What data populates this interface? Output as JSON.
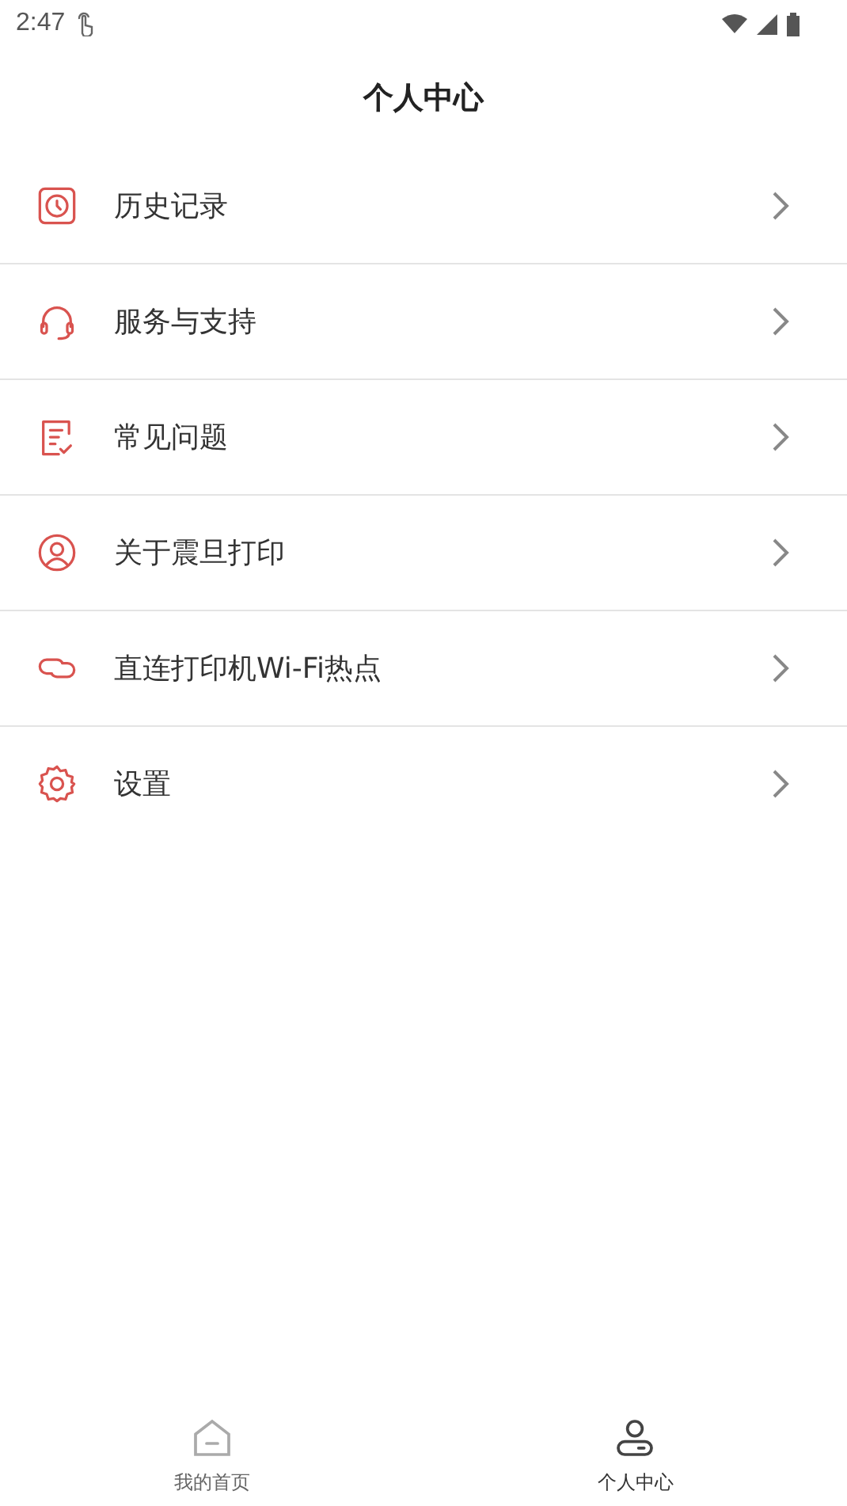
{
  "status_bar": {
    "time": "2:47"
  },
  "title": "个人中心",
  "menu": [
    {
      "kind": "history",
      "label": "历史记录"
    },
    {
      "kind": "service",
      "label": "服务与支持"
    },
    {
      "kind": "faq",
      "label": "常见问题"
    },
    {
      "kind": "about",
      "label": "关于震旦打印"
    },
    {
      "kind": "link",
      "label": "直连打印机Wi-Fi热点"
    },
    {
      "kind": "settings",
      "label": "设置"
    }
  ],
  "tabs": [
    {
      "kind": "home",
      "label": "我的首页",
      "selected": false
    },
    {
      "kind": "profile",
      "label": "个人中心",
      "selected": true
    }
  ]
}
